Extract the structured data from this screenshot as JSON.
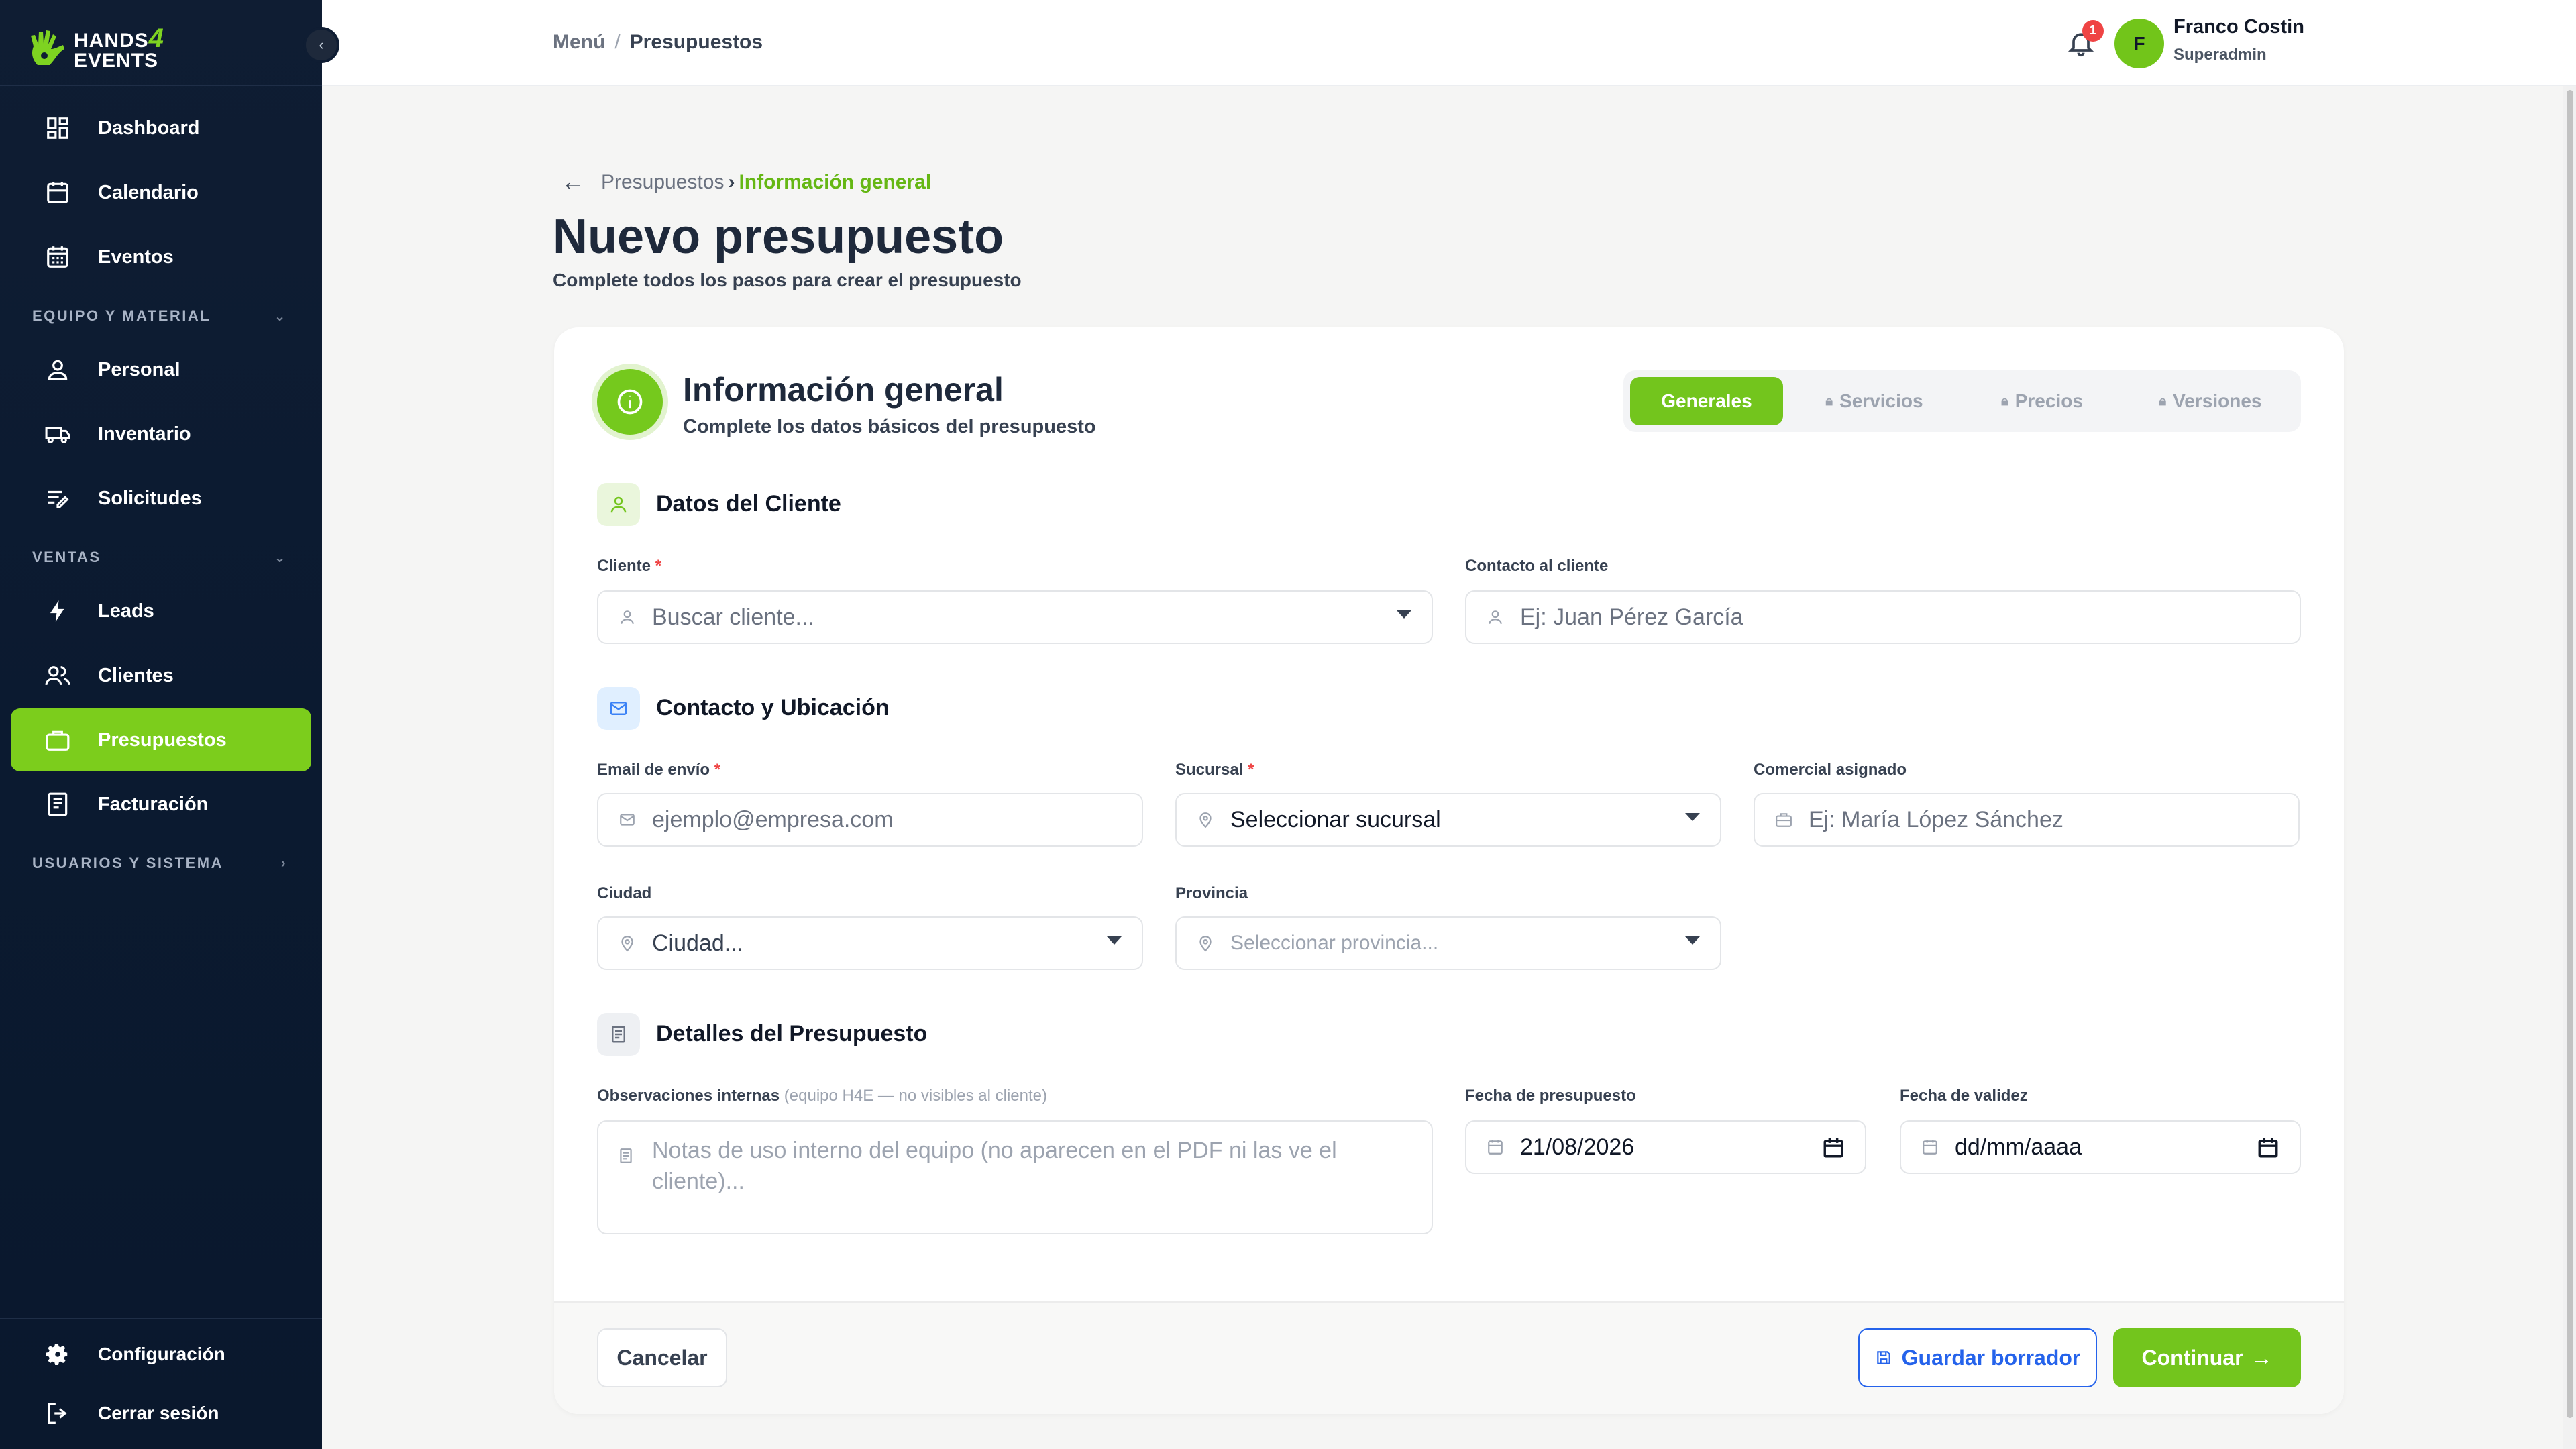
{
  "brand": {
    "line1": "HANDS",
    "line2": "EVENTS",
    "mark": "4"
  },
  "sidebar": {
    "items": [
      {
        "label": "Dashboard",
        "icon": "grid-icon"
      },
      {
        "label": "Calendario",
        "icon": "calendar-icon"
      },
      {
        "label": "Eventos",
        "icon": "calendar-days-icon"
      },
      {
        "label": "Personal",
        "icon": "user-icon"
      },
      {
        "label": "Inventario",
        "icon": "truck-icon"
      },
      {
        "label": "Solicitudes",
        "icon": "list-edit-icon"
      },
      {
        "label": "Leads",
        "icon": "bolt-icon"
      },
      {
        "label": "Clientes",
        "icon": "users-icon"
      },
      {
        "label": "Presupuestos",
        "icon": "briefcase-icon",
        "active": true
      },
      {
        "label": "Facturación",
        "icon": "receipt-icon"
      }
    ],
    "sections": {
      "equipo": "EQUIPO Y MATERIAL",
      "ventas": "VENTAS",
      "usuarios": "USUARIOS Y SISTEMA"
    },
    "bottom": {
      "config": "Configuración",
      "logout": "Cerrar sesión"
    },
    "collapse_glyph": "‹"
  },
  "topbar": {
    "crumb_root": "Menú",
    "crumb_sep": "/",
    "crumb_current": "Presupuestos",
    "notifications": "1",
    "avatar_initial": "F",
    "user_name": "Franco Costin",
    "user_role": "Superadmin"
  },
  "page": {
    "crumb_parent": "Presupuestos",
    "crumb_gt": "›",
    "crumb_current": "Información general",
    "title": "Nuevo presupuesto",
    "subtitle": "Complete todos los pasos para crear el presupuesto"
  },
  "card": {
    "title": "Información general",
    "subtitle": "Complete los datos básicos del presupuesto",
    "steps": [
      "Generales",
      "Servicios",
      "Precios",
      "Versiones"
    ]
  },
  "sections": {
    "cliente": "Datos del Cliente",
    "contacto": "Contacto y Ubicación",
    "detalles": "Detalles del Presupuesto"
  },
  "fields": {
    "cliente": {
      "label": "Cliente",
      "placeholder": "Buscar cliente..."
    },
    "contacto_cliente": {
      "label": "Contacto al cliente",
      "placeholder": "Ej: Juan Pérez García"
    },
    "email": {
      "label": "Email de envío",
      "placeholder": "ejemplo@empresa.com"
    },
    "sucursal": {
      "label": "Sucursal",
      "value": "Seleccionar sucursal"
    },
    "comercial": {
      "label": "Comercial asignado",
      "placeholder": "Ej: María López Sánchez"
    },
    "ciudad": {
      "label": "Ciudad",
      "value": "Ciudad..."
    },
    "provincia": {
      "label": "Provincia",
      "placeholder": "Seleccionar provincia..."
    },
    "observaciones": {
      "label": "Observaciones internas",
      "hint": "(equipo H4E — no visibles al cliente)",
      "placeholder": "Notas de uso interno del equipo (no aparecen en el PDF ni las ve el cliente)..."
    },
    "fecha_presupuesto": {
      "label": "Fecha de presupuesto",
      "value": "21/08/2026"
    },
    "fecha_validez": {
      "label": "Fecha de validez",
      "value": "dd/mm/aaaa"
    }
  },
  "required_mark": "*",
  "buttons": {
    "cancel": "Cancelar",
    "draft": "Guardar borrador",
    "continue": "Continuar"
  },
  "colors": {
    "accent": "#73c51d",
    "sidebar": "#0f1d33",
    "draft": "#2563eb",
    "badge": "#ef4444"
  }
}
